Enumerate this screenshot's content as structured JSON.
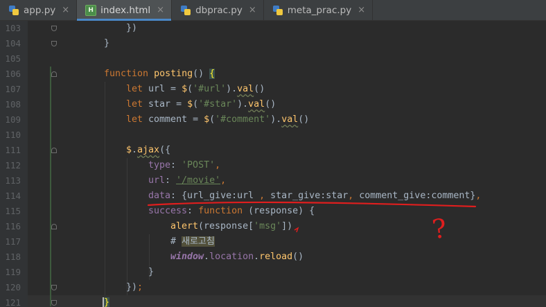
{
  "tabs": [
    {
      "label": "app.py",
      "icon": "python-file-icon",
      "active": false
    },
    {
      "label": "index.html",
      "icon": "html-file-icon",
      "active": true
    },
    {
      "label": "dbprac.py",
      "icon": "python-file-icon",
      "active": false
    },
    {
      "label": "meta_prac.py",
      "icon": "python-file-icon",
      "active": false
    }
  ],
  "close_glyph": "×",
  "line_numbers": [
    "103",
    "104",
    "105",
    "106",
    "107",
    "108",
    "109",
    "110",
    "111",
    "112",
    "113",
    "114",
    "115",
    "116",
    "117",
    "118",
    "119",
    "120",
    "121"
  ],
  "code": {
    "l103": {
      "a": "})"
    },
    "l104": {
      "a": "}"
    },
    "l106": {
      "kw": "function",
      "fn": "posting",
      "paren": "()",
      "sp": " ",
      "brace": "{"
    },
    "l107": {
      "kw": "let",
      "a": " url = ",
      "fn": "$",
      "b": "(",
      "str": "'#url'",
      "c": ").",
      "fn2": "val",
      "d": "()"
    },
    "l108": {
      "kw": "let",
      "a": " star = ",
      "fn": "$",
      "b": "(",
      "str": "'#star'",
      "c": ").",
      "fn2": "val",
      "d": "()"
    },
    "l109": {
      "kw": "let",
      "a": " comment = ",
      "fn": "$",
      "b": "(",
      "str": "'#comment'",
      "c": ").",
      "fn2": "val",
      "d": "()"
    },
    "l111": {
      "fn": "$",
      "a": ".",
      "fn2": "ajax",
      "b": "({"
    },
    "l112": {
      "prop": "type",
      "a": ": ",
      "str": "'POST'",
      "kw": ","
    },
    "l113": {
      "prop": "url",
      "a": ": ",
      "str": "'/movie'",
      "kw": ","
    },
    "l114": {
      "prop": "data",
      "a": ": {url_give:url ",
      "kw1": ",",
      "b": " star_give:star",
      "kw2": ",",
      "c": " comment_give:comment}",
      "kw3": ","
    },
    "l115": {
      "prop": "success",
      "a": ": ",
      "kw": "function",
      "b": " (response) {"
    },
    "l116": {
      "fn": "alert",
      "a": "(response[",
      "str": "'msg'",
      "b": "])"
    },
    "l117": {
      "cm": "# ",
      "ko": "새로고침"
    },
    "l118": {
      "glob": "window",
      "a": ".",
      "prop": "location",
      "b": ".",
      "fn": "reload",
      "c": "()"
    },
    "l119": {
      "a": "}"
    },
    "l120": {
      "a": "})",
      "kw": ";"
    },
    "l121": {
      "a": "}"
    }
  },
  "annotation": {
    "text": "?",
    "color": "#e01e1e"
  }
}
